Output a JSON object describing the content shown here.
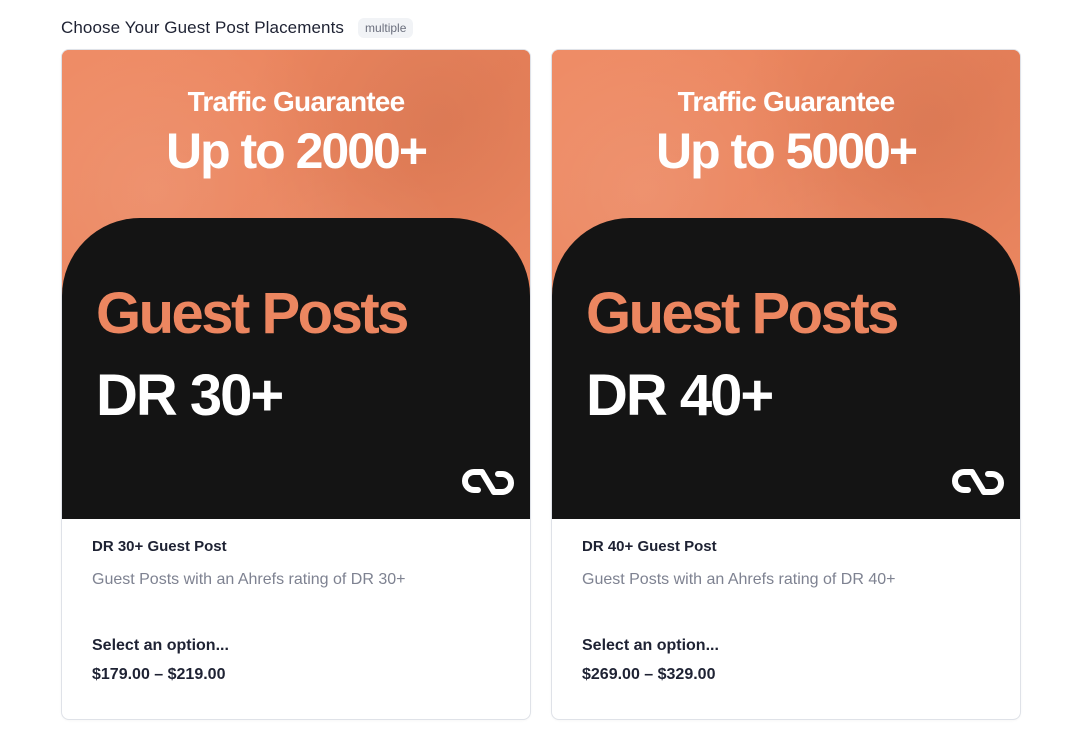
{
  "header": {
    "title": "Choose Your Guest Post Placements",
    "badge": "multiple"
  },
  "cards": [
    {
      "banner": {
        "traffic_label": "Traffic Guarantee",
        "traffic_value": "Up to 2000+",
        "headline": "Guest Posts",
        "dr_label": "DR 30+",
        "icon": "link-icon"
      },
      "title": "DR 30+ Guest Post",
      "description": "Guest Posts with an Ahrefs rating of DR 30+",
      "select_label": "Select an option...",
      "price_range": "$179.00 – $219.00"
    },
    {
      "banner": {
        "traffic_label": "Traffic Guarantee",
        "traffic_value": "Up to 5000+",
        "headline": "Guest Posts",
        "dr_label": "DR 40+",
        "icon": "link-icon"
      },
      "title": "DR 40+ Guest Post",
      "description": "Guest Posts with an Ahrefs rating of DR 40+",
      "select_label": "Select an option...",
      "price_range": "$269.00 – $329.00"
    }
  ],
  "colors": {
    "banner_orange": "#ec8660",
    "dark_panel": "#141414",
    "text_dark": "#1e2233",
    "text_muted": "#7e8291"
  }
}
